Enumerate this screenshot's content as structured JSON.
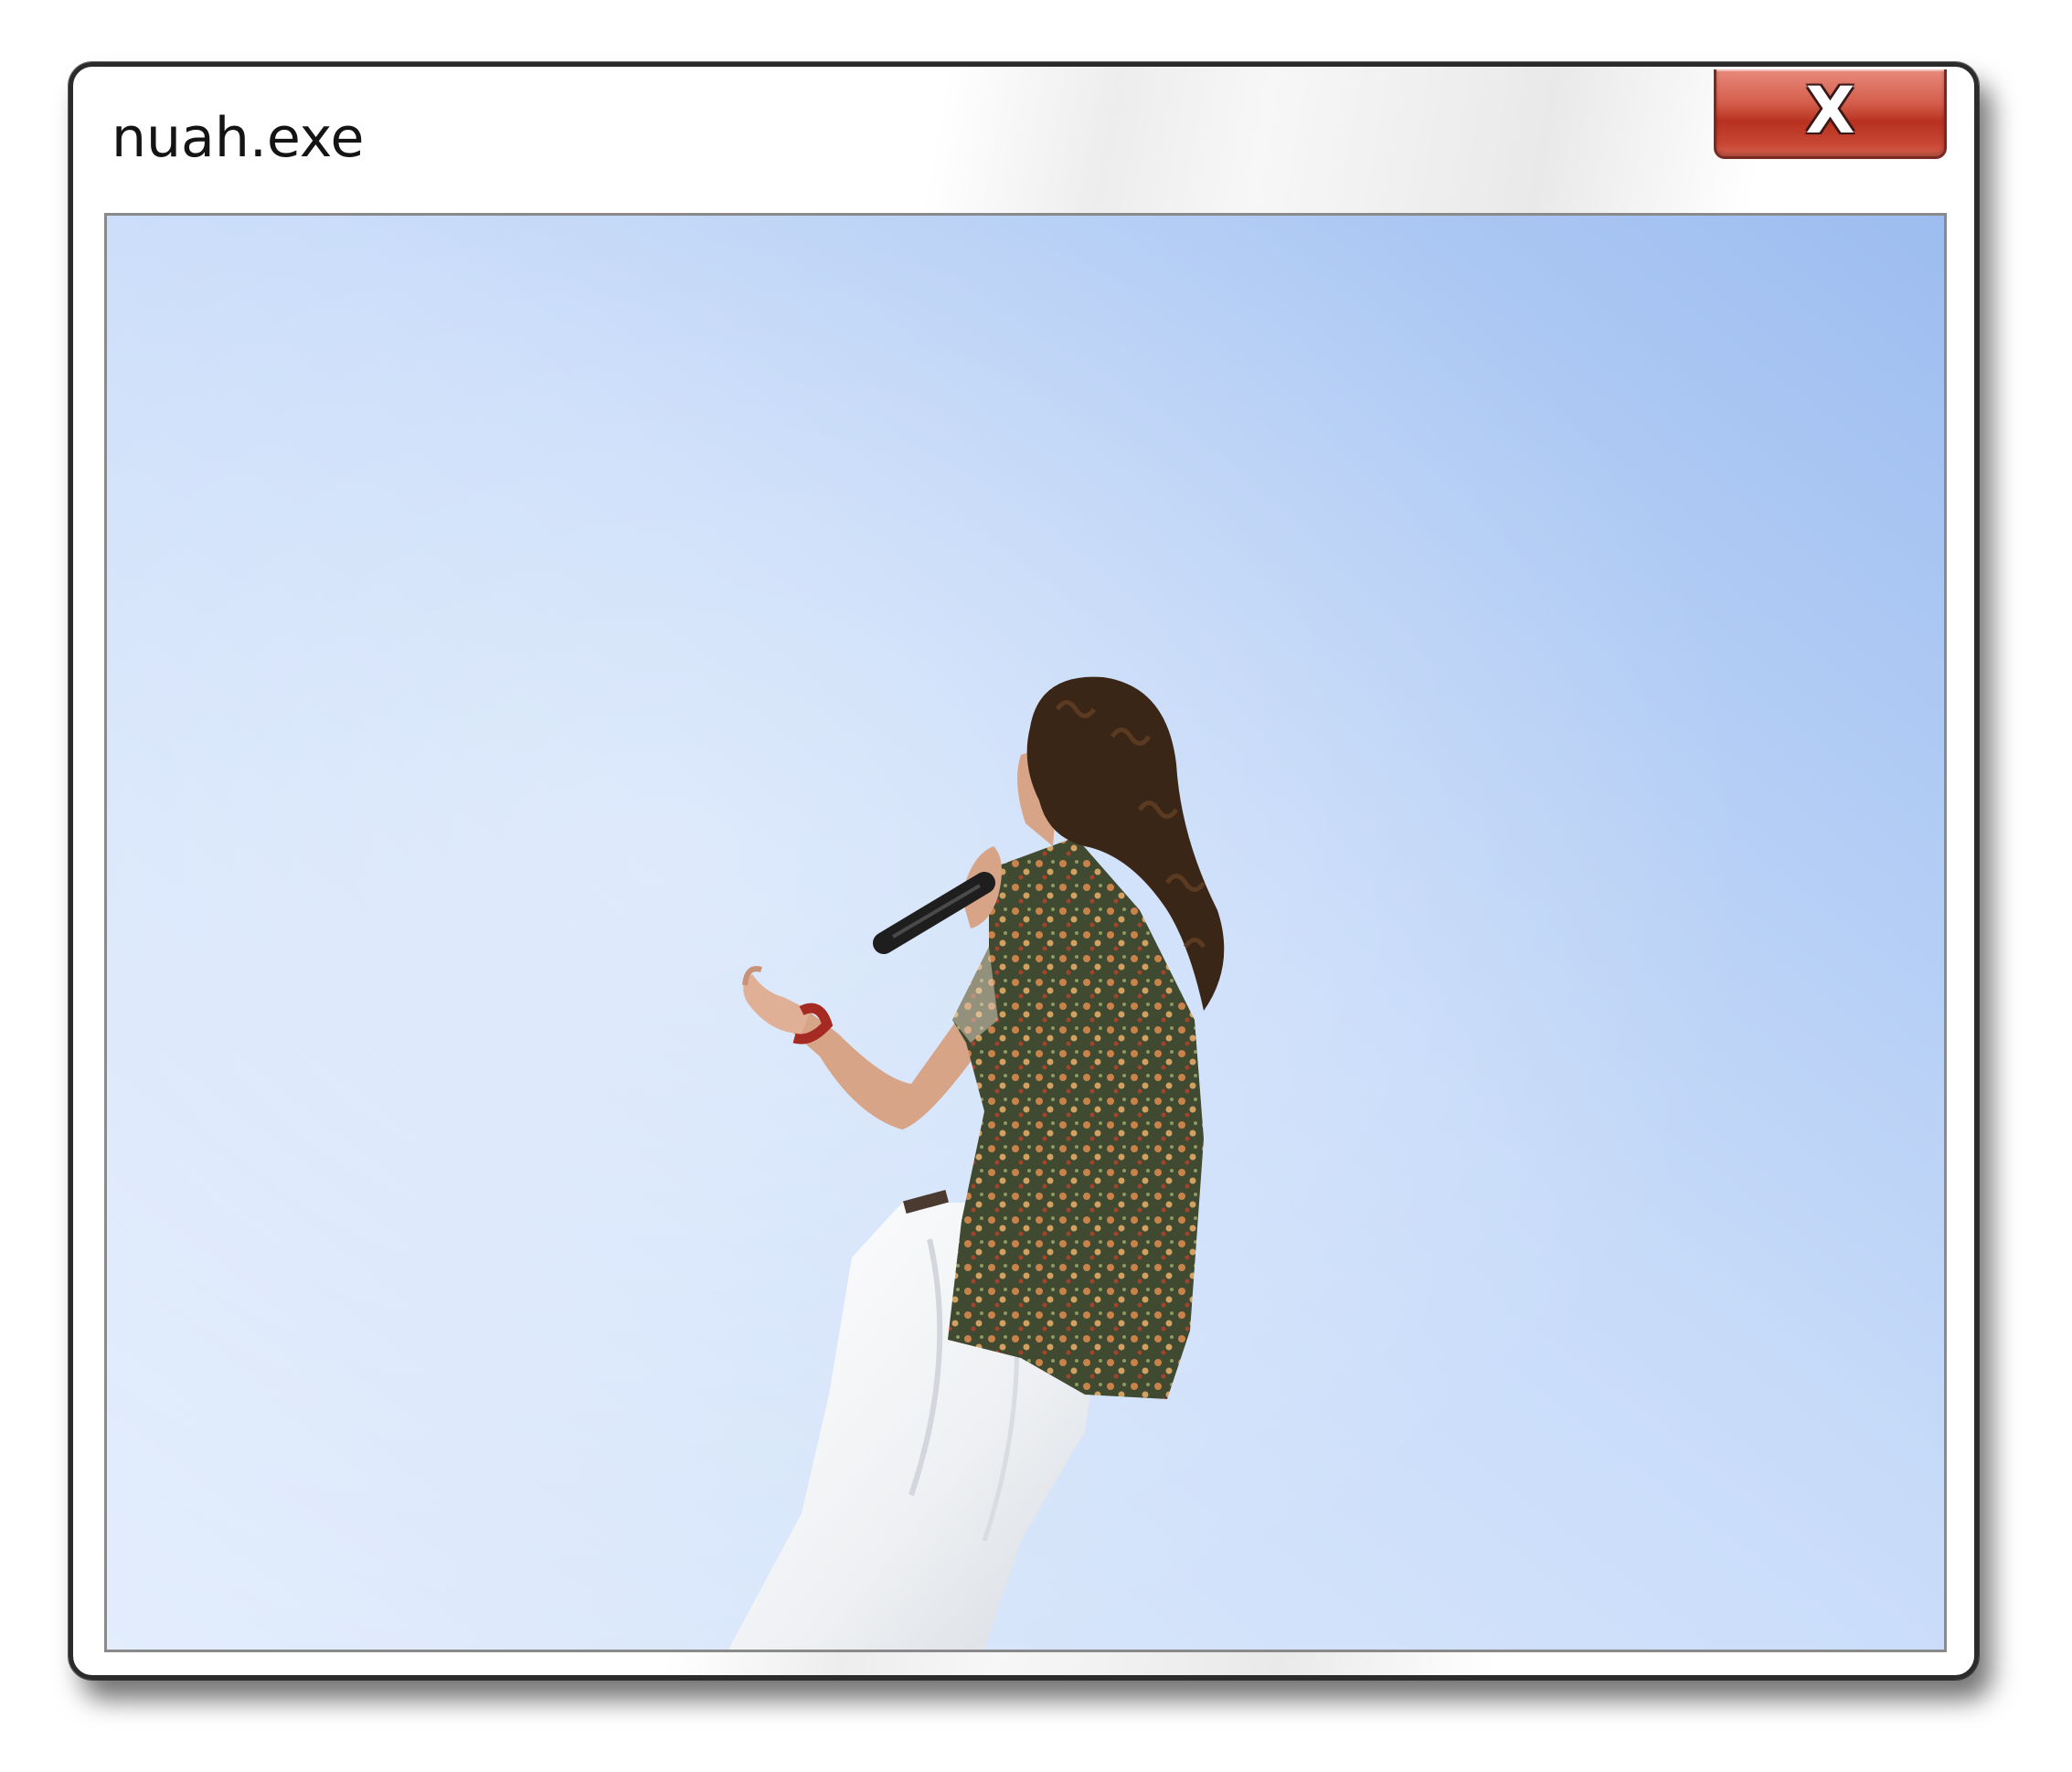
{
  "window": {
    "title": "nuah.exe",
    "close_button": {
      "label": "X",
      "icon": "close-icon",
      "color": "#c8412f"
    }
  },
  "content": {
    "image": "photo-singer-with-microphone-against-sky",
    "sky_color": "#c2d7f7"
  }
}
